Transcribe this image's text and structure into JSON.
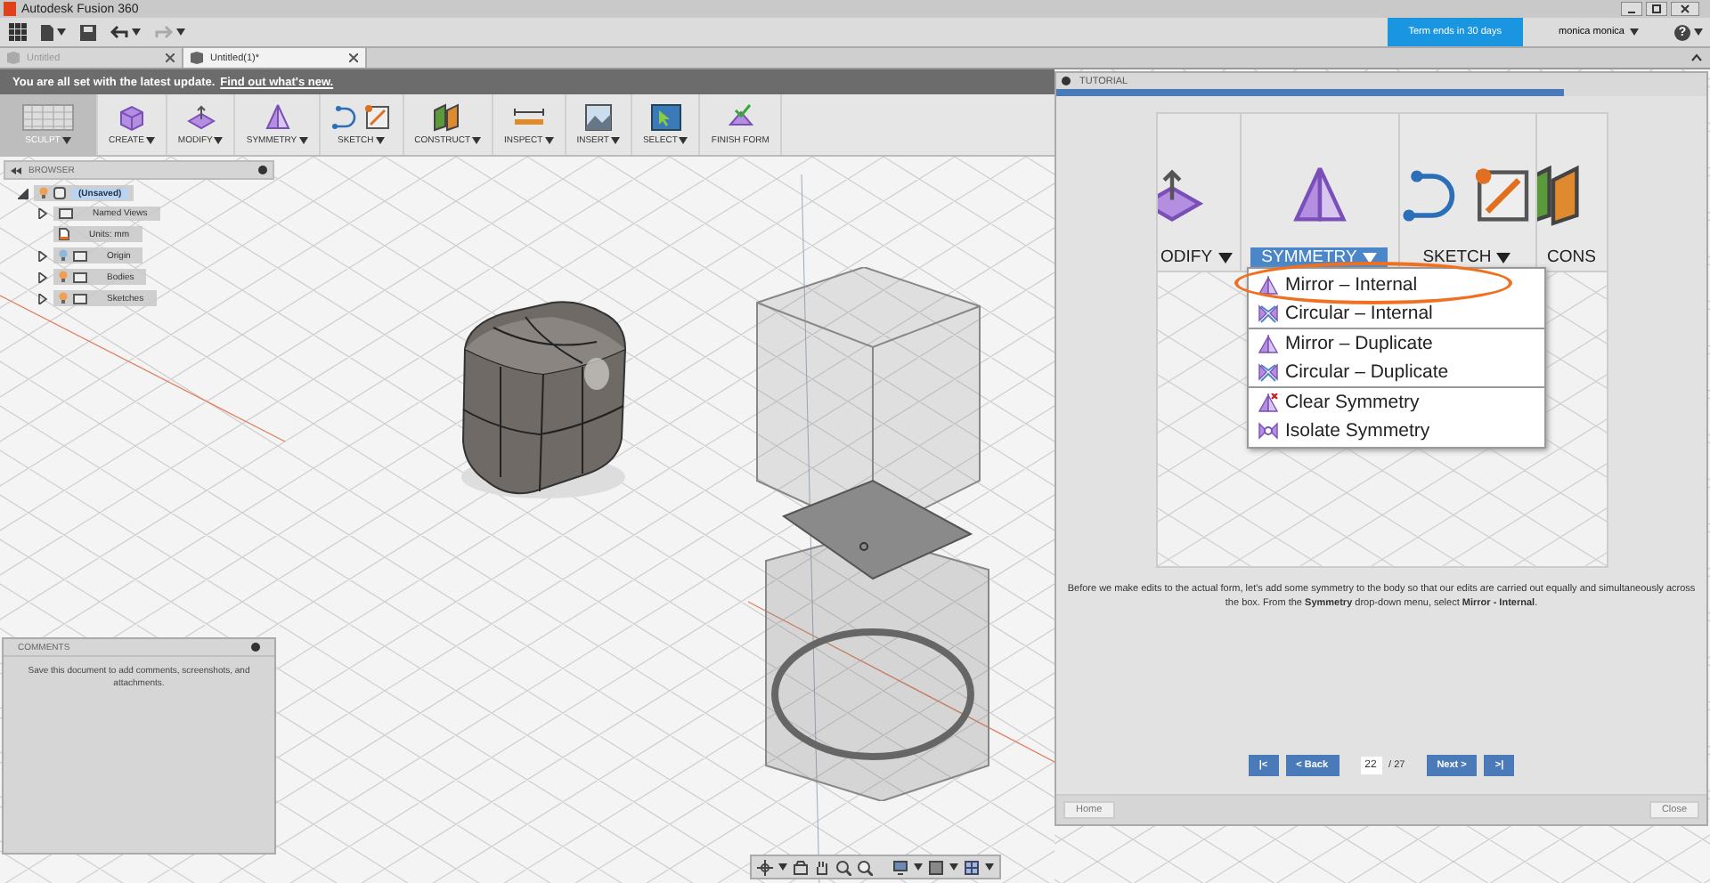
{
  "window": {
    "title": "Autodesk Fusion 360"
  },
  "account": {
    "notice": "Term ends in 30 days",
    "user": "monica monica",
    "help": "?"
  },
  "document_tabs": [
    {
      "label": "Untitled",
      "selected": false
    },
    {
      "label": "Untitled(1)*",
      "selected": true
    }
  ],
  "notification": {
    "text": "You are all set with the latest update.",
    "link": "Find out what's new."
  },
  "toolbar": [
    {
      "label": "SCULPT",
      "kind": "sculpt",
      "selected": true
    },
    {
      "label": "CREATE",
      "kind": "create",
      "selected": false
    },
    {
      "label": "MODIFY",
      "kind": "modify",
      "selected": false
    },
    {
      "label": "SYMMETRY",
      "kind": "symmetry",
      "selected": false
    },
    {
      "label": "SKETCH",
      "kind": "sketch",
      "selected": false
    },
    {
      "label": "CONSTRUCT",
      "kind": "construct",
      "selected": false
    },
    {
      "label": "INSPECT",
      "kind": "inspect",
      "selected": false
    },
    {
      "label": "INSERT",
      "kind": "insert",
      "selected": false
    },
    {
      "label": "SELECT",
      "kind": "select",
      "selected": false
    },
    {
      "label": "FINISH FORM",
      "kind": "finish",
      "selected": false
    }
  ],
  "browser": {
    "title": "BROWSER",
    "root": {
      "label": "(Unsaved)",
      "selected": true,
      "expanded": true,
      "children": [
        {
          "label": "Named Views",
          "kind": "views",
          "expanded": false
        },
        {
          "label": "Units: mm",
          "kind": "units"
        },
        {
          "label": "Origin",
          "kind": "folder",
          "visible": false,
          "expanded": false
        },
        {
          "label": "Bodies",
          "kind": "folder",
          "visible": true,
          "expanded": false
        },
        {
          "label": "Sketches",
          "kind": "folder",
          "visible": true,
          "expanded": false
        }
      ]
    }
  },
  "comments": {
    "title": "COMMENTS",
    "message": "Save this document to add comments, screenshots, and attachments."
  },
  "tutorial": {
    "title": "TUTORIAL",
    "progress": {
      "level": 0.78
    },
    "illustration": {
      "tabs": [
        {
          "label": "ODIFY",
          "kind": "modify",
          "selected": false
        },
        {
          "label": "SYMMETRY",
          "kind": "symmetry",
          "selected": true
        },
        {
          "label": "SKETCH",
          "kind": "sketch",
          "selected": false
        },
        {
          "label": "CONS",
          "kind": "construct",
          "selected": false
        }
      ],
      "menu": [
        {
          "label": "Mirror – Internal",
          "kind": "mirror",
          "separator_before": false,
          "circled": true
        },
        {
          "label": "Circular – Internal",
          "kind": "circular",
          "separator_before": false,
          "circled": false
        },
        {
          "label": "Mirror – Duplicate",
          "kind": "mirror",
          "separator_before": true,
          "circled": false
        },
        {
          "label": "Circular – Duplicate",
          "kind": "circular",
          "separator_before": false,
          "circled": false
        },
        {
          "label": "Clear Symmetry",
          "kind": "clear",
          "separator_before": true,
          "circled": false
        },
        {
          "label": "Isolate Symmetry",
          "kind": "isolate",
          "separator_before": false,
          "circled": false
        }
      ]
    },
    "instruction": "Before we make edits to the actual form, let's add some symmetry to the body so that our edits are carried out equally and simultaneously across the box. From the **Symmetry** drop-down menu, select **Mirror - Internal**.",
    "nav": {
      "first": "|<",
      "back": "< Back",
      "page": "22",
      "total": "/ 27",
      "next": "Next >",
      "last": ">|"
    },
    "home": "Home",
    "close": "Close"
  }
}
